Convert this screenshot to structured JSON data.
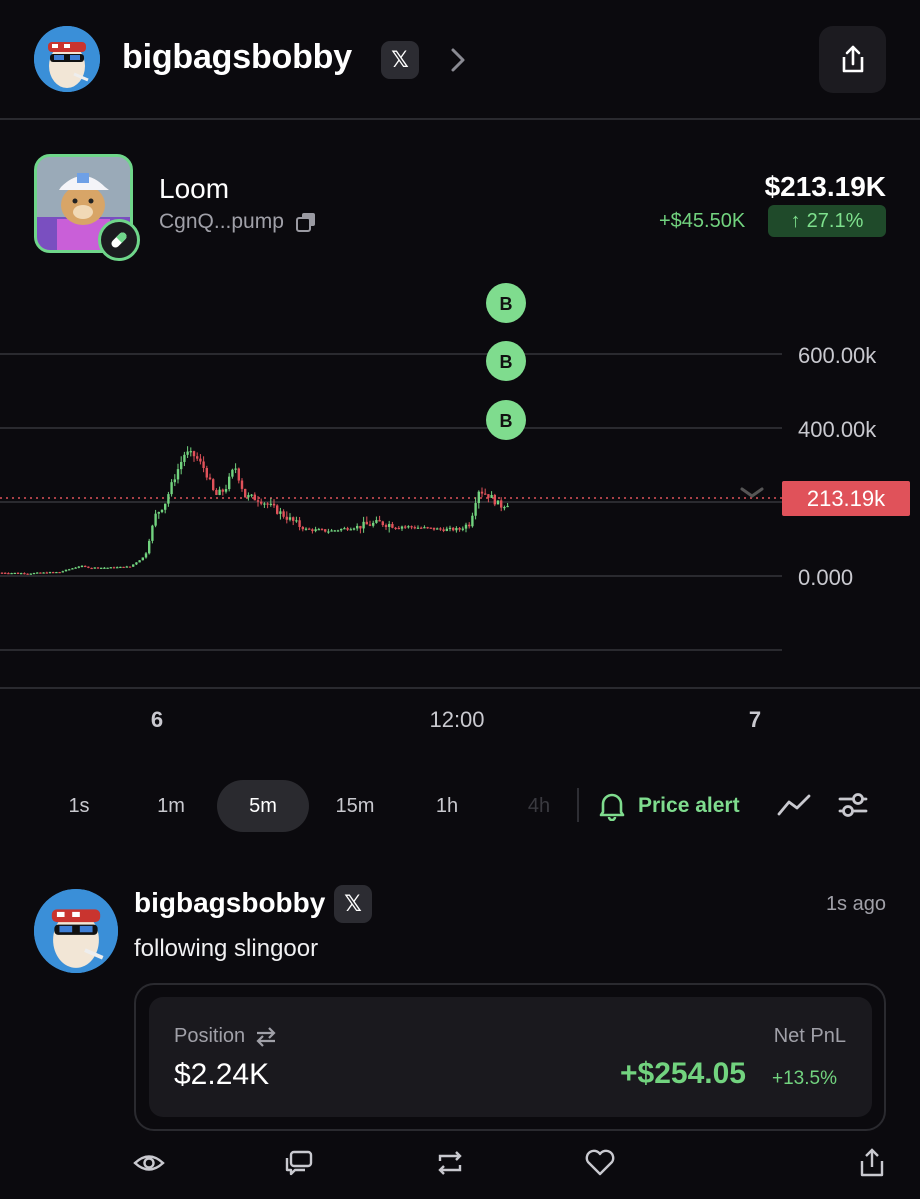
{
  "header": {
    "username": "bigbagsbobby",
    "x_label": "𝕏"
  },
  "token": {
    "name": "Loom",
    "address": "CgnQ...pump",
    "market_cap": "$213.19K",
    "change_abs": "+$45.50K",
    "change_pct": "27.1%",
    "change_arrow": "↑"
  },
  "chart_data": {
    "type": "candlestick",
    "y_tick_labels": [
      "600.00k",
      "400.00k",
      "0.000"
    ],
    "x_tick_labels": [
      "6",
      "12:00",
      "7"
    ],
    "current_price_label": "213.19k",
    "trade_markers": [
      "B",
      "B",
      "B"
    ],
    "trend": [
      [
        0,
        10
      ],
      [
        30,
        8
      ],
      [
        60,
        12
      ],
      [
        80,
        30
      ],
      [
        90,
        25
      ],
      [
        110,
        25
      ],
      [
        130,
        28
      ],
      [
        145,
        60
      ],
      [
        155,
        180
      ],
      [
        165,
        220
      ],
      [
        175,
        300
      ],
      [
        185,
        370
      ],
      [
        195,
        360
      ],
      [
        205,
        320
      ],
      [
        215,
        240
      ],
      [
        225,
        260
      ],
      [
        235,
        330
      ],
      [
        245,
        240
      ],
      [
        260,
        230
      ],
      [
        275,
        200
      ],
      [
        290,
        170
      ],
      [
        305,
        140
      ],
      [
        330,
        135
      ],
      [
        360,
        150
      ],
      [
        380,
        160
      ],
      [
        400,
        150
      ],
      [
        420,
        145
      ],
      [
        440,
        140
      ],
      [
        460,
        140
      ],
      [
        470,
        160
      ],
      [
        478,
        260
      ],
      [
        490,
        240
      ],
      [
        500,
        210
      ],
      [
        508,
        220
      ]
    ],
    "ylim": [
      0,
      600
    ]
  },
  "timeframes": [
    "1s",
    "1m",
    "5m",
    "15m",
    "1h",
    "4h"
  ],
  "active_timeframe": "5m",
  "price_alert_label": "Price alert",
  "post": {
    "username": "bigbagsbobby",
    "x_label": "𝕏",
    "time": "1s ago",
    "text": "following slingoor",
    "position_label": "Position",
    "position_value": "$2.24K",
    "pnl_label": "Net PnL",
    "pnl_value": "+$254.05",
    "pnl_pct": "+13.5%"
  },
  "colors": {
    "green": "#72d37f",
    "red": "#e0525a",
    "bg": "#0b0a0e"
  }
}
